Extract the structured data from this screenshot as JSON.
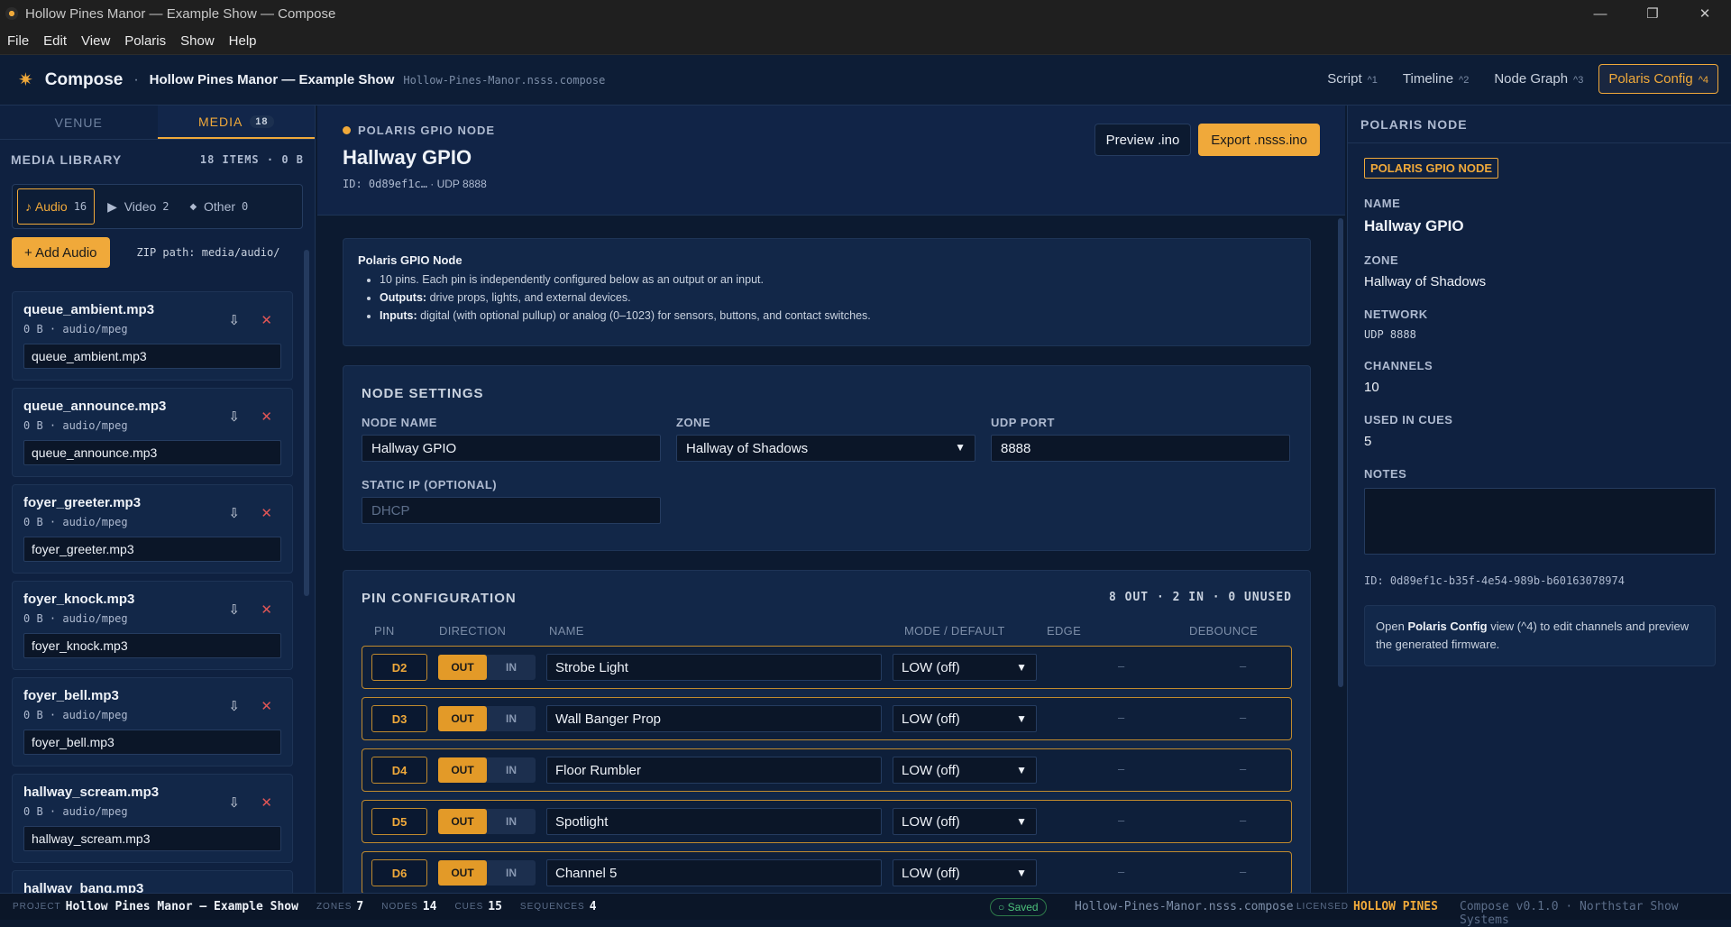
{
  "window": {
    "title": "Hollow Pines Manor — Example Show — Compose",
    "controls": [
      "—",
      "❐",
      "✕"
    ]
  },
  "menu": [
    "File",
    "Edit",
    "View",
    "Polaris",
    "Show",
    "Help"
  ],
  "header": {
    "brand": "Compose",
    "show": "Hollow Pines Manor — Example Show",
    "file": "Hollow-Pines-Manor.nsss.compose",
    "views": [
      {
        "label": "Script",
        "key": "^1"
      },
      {
        "label": "Timeline",
        "key": "^2"
      },
      {
        "label": "Node Graph",
        "key": "^3"
      },
      {
        "label": "Polaris Config",
        "key": "^4"
      }
    ]
  },
  "sidebar": {
    "tabs": [
      {
        "label": "VENUE"
      },
      {
        "label": "MEDIA",
        "badge": "18"
      }
    ],
    "library_title": "MEDIA LIBRARY",
    "library_count": "18 ITEMS · 0 B",
    "filters": [
      {
        "icon": "♪",
        "label": "Audio",
        "count": "16"
      },
      {
        "icon": "▶",
        "label": "Video",
        "count": "2"
      },
      {
        "icon": "◆",
        "label": "Other",
        "count": "0"
      }
    ],
    "add_label": "+ Add Audio",
    "zip_path": "ZIP path: media/audio/",
    "items": [
      {
        "name": "queue_ambient.mp3",
        "meta": "0 B · audio/mpeg",
        "value": "queue_ambient.mp3"
      },
      {
        "name": "queue_announce.mp3",
        "meta": "0 B · audio/mpeg",
        "value": "queue_announce.mp3"
      },
      {
        "name": "foyer_greeter.mp3",
        "meta": "0 B · audio/mpeg",
        "value": "foyer_greeter.mp3"
      },
      {
        "name": "foyer_knock.mp3",
        "meta": "0 B · audio/mpeg",
        "value": "foyer_knock.mp3"
      },
      {
        "name": "foyer_bell.mp3",
        "meta": "0 B · audio/mpeg",
        "value": "foyer_bell.mp3"
      },
      {
        "name": "hallway_scream.mp3",
        "meta": "0 B · audio/mpeg",
        "value": "hallway_scream.mp3"
      },
      {
        "name": "hallway_bang.mp3",
        "meta": "",
        "value": ""
      }
    ]
  },
  "node": {
    "kind": "POLARIS GPIO NODE",
    "name": "Hallway GPIO",
    "id_short": "ID: 0d89ef1c…",
    "udp": "· UDP 8888",
    "preview_label": "Preview .ino",
    "export_label": "Export .nsss.ino",
    "info": {
      "title": "Polaris GPIO Node",
      "line1": "10 pins. Each pin is independently configured below as an output or an input.",
      "outputs_label": "Outputs:",
      "outputs_text": "drive props, lights, and external devices.",
      "inputs_label": "Inputs:",
      "inputs_text": "digital (with optional pullup) or analog (0–1023) for sensors, buttons, and contact switches."
    },
    "settings": {
      "title": "NODE SETTINGS",
      "name_label": "NODE NAME",
      "name_value": "Hallway GPIO",
      "zone_label": "ZONE",
      "zone_value": "Hallway of Shadows",
      "port_label": "UDP PORT",
      "port_value": "8888",
      "ip_label": "STATIC IP (OPTIONAL)",
      "ip_placeholder": "DHCP"
    },
    "pins": {
      "title": "PIN CONFIGURATION",
      "summary": "8 OUT · 2 IN · 0 UNUSED",
      "columns": [
        "PIN",
        "DIRECTION",
        "NAME",
        "MODE / DEFAULT",
        "EDGE",
        "DEBOUNCE"
      ],
      "out_label": "OUT",
      "in_label": "IN",
      "rows": [
        {
          "pin": "D2",
          "dir": "OUT",
          "name": "Strobe Light",
          "mode": "LOW (off)",
          "edge": "–",
          "debounce": "–"
        },
        {
          "pin": "D3",
          "dir": "OUT",
          "name": "Wall Banger Prop",
          "mode": "LOW (off)",
          "edge": "–",
          "debounce": "–"
        },
        {
          "pin": "D4",
          "dir": "OUT",
          "name": "Floor Rumbler",
          "mode": "LOW (off)",
          "edge": "–",
          "debounce": "–"
        },
        {
          "pin": "D5",
          "dir": "OUT",
          "name": "Spotlight",
          "mode": "LOW (off)",
          "edge": "–",
          "debounce": "–"
        },
        {
          "pin": "D6",
          "dir": "OUT",
          "name": "Channel 5",
          "mode": "LOW (off)",
          "edge": "–",
          "debounce": "–"
        }
      ]
    }
  },
  "inspector": {
    "title": "POLARIS NODE",
    "tag": "POLARIS GPIO NODE",
    "name_label": "NAME",
    "name": "Hallway GPIO",
    "zone_label": "ZONE",
    "zone": "Hallway of Shadows",
    "network_label": "NETWORK",
    "network": "UDP 8888",
    "channels_label": "CHANNELS",
    "channels": "10",
    "used_label": "USED IN CUES",
    "used": "5",
    "notes_label": "NOTES",
    "id": "ID: 0d89ef1c-b35f-4e54-989b-b60163078974",
    "hint_pre": "Open",
    "hint_bold": "Polaris Config",
    "hint_post": "view (^4) to edit channels and preview the generated firmware."
  },
  "status": {
    "project_label": "PROJECT",
    "project": "Hollow Pines Manor — Example Show",
    "zones_label": "ZONES",
    "zones": "7",
    "nodes_label": "NODES",
    "nodes": "14",
    "cues_label": "CUES",
    "cues": "15",
    "sequences_label": "SEQUENCES",
    "sequences": "4",
    "saved": "○ Saved",
    "file": "Hollow-Pines-Manor.nsss.compose",
    "licensed_label": "LICENSED",
    "licensed": "HOLLOW PINES",
    "version": "Compose v0.1.0 · Northstar Show Systems"
  }
}
